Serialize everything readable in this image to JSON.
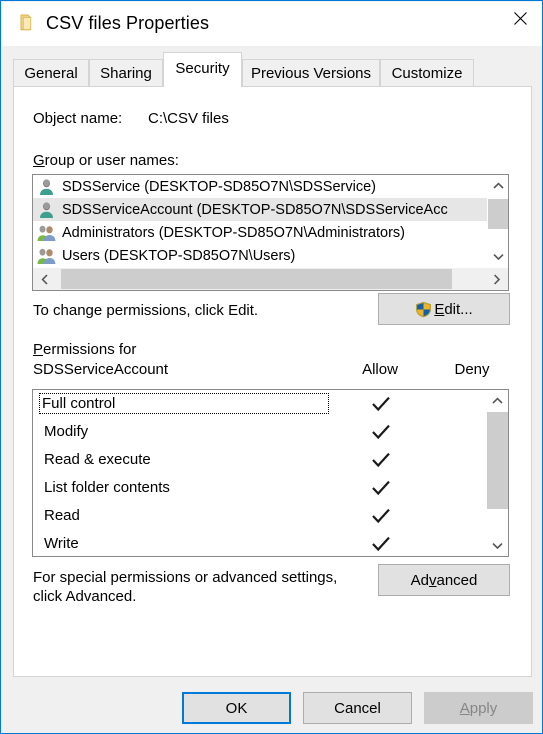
{
  "window": {
    "title": "CSV files Properties",
    "folder_icon": "folder-icon",
    "close_icon": "close-icon",
    "border_color": "#0078d7"
  },
  "tabs": [
    {
      "label": "General",
      "active": false
    },
    {
      "label": "Sharing",
      "active": false
    },
    {
      "label": "Security",
      "active": true
    },
    {
      "label": "Previous Versions",
      "active": false
    },
    {
      "label": "Customize",
      "active": false
    }
  ],
  "security": {
    "object_name_label": "Object name:",
    "object_name_value": "C:\\CSV files",
    "group_label_prefix": "G",
    "group_label_rest": "roup or user names:",
    "group_users": [
      {
        "name": "SDSService (DESKTOP-SD85O7N\\SDSService)",
        "icon": "user-icon",
        "selected": false
      },
      {
        "name": "SDSServiceAccount (DESKTOP-SD85O7N\\SDSServiceAcc",
        "icon": "user-icon",
        "selected": true
      },
      {
        "name": "Administrators (DESKTOP-SD85O7N\\Administrators)",
        "icon": "group-icon",
        "selected": false
      },
      {
        "name": "Users (DESKTOP-SD85O7N\\Users)",
        "icon": "group-icon",
        "selected": false
      }
    ],
    "change_permissions_text": "To change permissions, click Edit.",
    "edit_button": {
      "prefix": "",
      "accesskey": "E",
      "suffix": "dit...",
      "icon": "uac-shield-icon"
    },
    "permissions_for_line1": "ermissions for",
    "permissions_for_accesskey": "P",
    "permissions_for_line2": "SDSServiceAccount",
    "column_allow": "Allow",
    "column_deny": "Deny",
    "permissions": [
      {
        "name": "Full control",
        "allow": true,
        "deny": false,
        "focused": true
      },
      {
        "name": "Modify",
        "allow": true,
        "deny": false,
        "focused": false
      },
      {
        "name": "Read & execute",
        "allow": true,
        "deny": false,
        "focused": false
      },
      {
        "name": "List folder contents",
        "allow": true,
        "deny": false,
        "focused": false
      },
      {
        "name": "Read",
        "allow": true,
        "deny": false,
        "focused": false
      },
      {
        "name": "Write",
        "allow": true,
        "deny": false,
        "focused": false
      }
    ],
    "advanced_text_line1": "For special permissions or advanced settings,",
    "advanced_text_line2": "click Advanced.",
    "advanced_button": {
      "prefix": "Ad",
      "accesskey": "v",
      "suffix": "anced"
    }
  },
  "footer": {
    "ok": "OK",
    "cancel": "Cancel",
    "apply_accesskey": "A",
    "apply_rest": "pply",
    "apply_disabled": true
  },
  "scrollbars": {
    "up_icon": "chevron-up-icon",
    "down_icon": "chevron-down-icon",
    "left_icon": "chevron-left-icon",
    "right_icon": "chevron-right-icon"
  }
}
